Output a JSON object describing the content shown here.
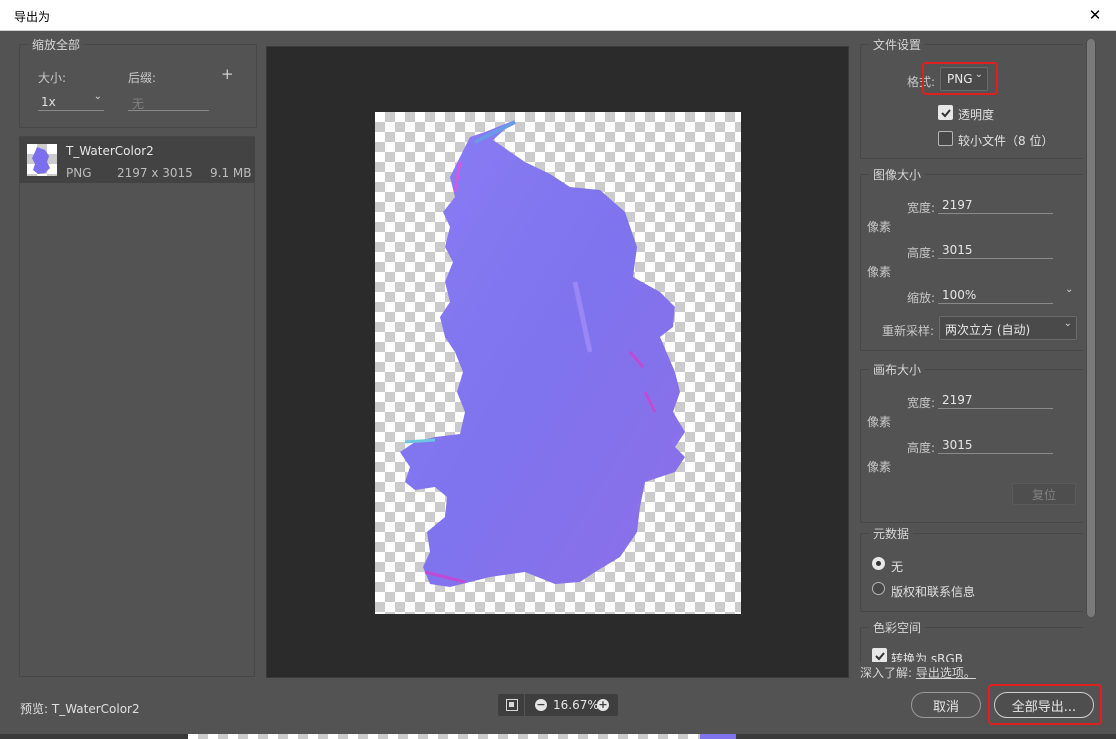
{
  "window": {
    "title": "导出为",
    "close_glyph": "✕"
  },
  "scale_panel": {
    "legend": "缩放全部",
    "size_label": "大小:",
    "suffix_label": "后缀:",
    "add_glyph": "+",
    "size_value": "1x",
    "suffix_placeholder": "无"
  },
  "asset": {
    "name": "T_WaterColor2",
    "format": "PNG",
    "dimensions": "2197 x 3015",
    "file_size": "9.1 MB"
  },
  "preview": {
    "label": "预览: T_WaterColor2",
    "zoom": "16.67%"
  },
  "file_settings": {
    "legend": "文件设置",
    "format_label": "格式:",
    "format_value": "PNG",
    "transparency_label": "透明度",
    "transparency_checked": true,
    "smaller_file_label": "较小文件（8 位）",
    "smaller_file_checked": false
  },
  "image_size": {
    "legend": "图像大小",
    "width_label": "宽度:",
    "width_value": "2197",
    "height_label": "高度:",
    "height_value": "3015",
    "unit": "像素",
    "scale_label": "缩放:",
    "scale_value": "100%",
    "resample_label": "重新采样:",
    "resample_value": "两次立方 (自动)"
  },
  "canvas_size": {
    "legend": "画布大小",
    "width_label": "宽度:",
    "width_value": "2197",
    "height_label": "高度:",
    "height_value": "3015",
    "unit": "像素",
    "reset_label": "复位"
  },
  "metadata": {
    "legend": "元数据",
    "option_none": "无",
    "option_copyright": "版权和联系信息",
    "selected": "无"
  },
  "color_space": {
    "legend": "色彩空间",
    "convert_label": "转换为 sRGB"
  },
  "learn_more": {
    "prefix": "深入了解:",
    "link": "导出选项。"
  },
  "buttons": {
    "cancel": "取消",
    "export_all": "全部导出..."
  },
  "colors": {
    "highlight": "#e02020",
    "dialog_bg": "#535353",
    "canvas_bg": "#2b2b2b"
  }
}
